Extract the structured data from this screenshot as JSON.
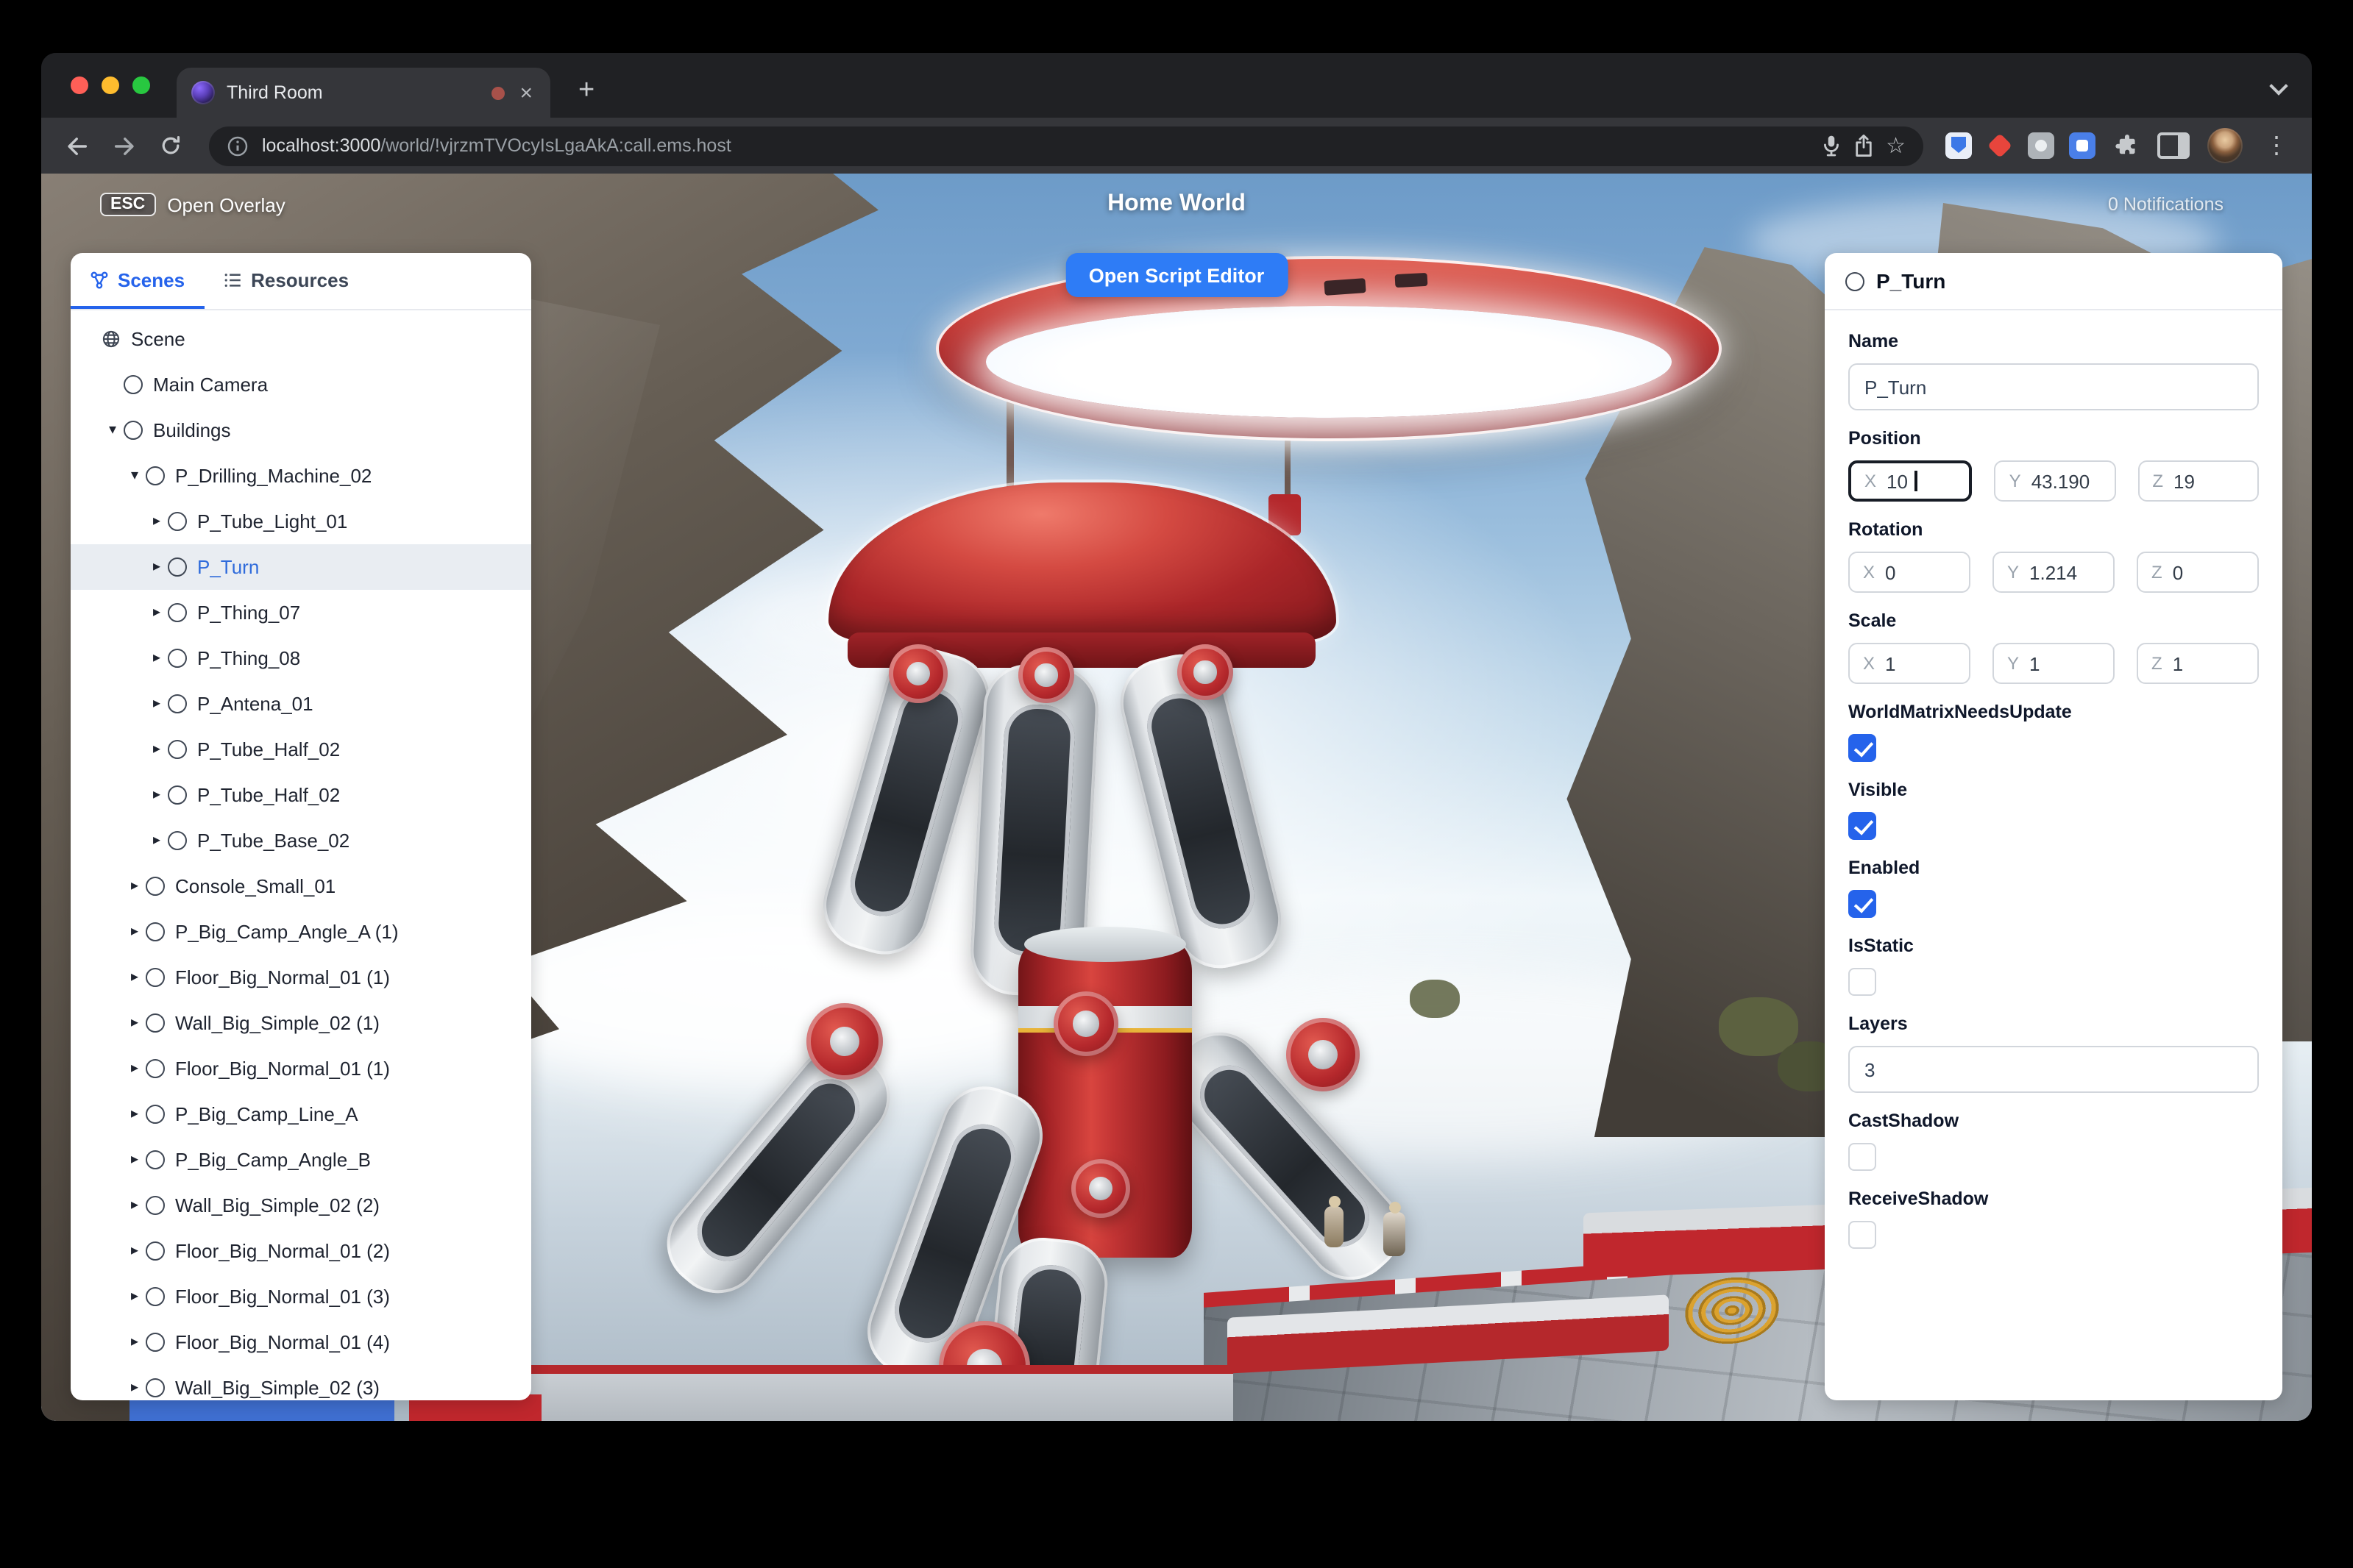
{
  "browser": {
    "tab_title": "Third Room",
    "url_host": "localhost:3000",
    "url_path": "/world/!vjrzmTVOcyIsLgaAkA:call.ems.host"
  },
  "icons": {
    "close": "×",
    "new_tab": "+",
    "star": "☆",
    "kebab": "⋮",
    "expander_open": "▾",
    "expander_closed": "▸"
  },
  "hud": {
    "esc": "ESC",
    "open_overlay": "Open Overlay",
    "title": "Home World",
    "notifications": "0 Notifications",
    "script_button": "Open Script Editor"
  },
  "left_panel": {
    "tabs": [
      {
        "label": "Scenes",
        "active": true
      },
      {
        "label": "Resources",
        "active": false
      }
    ],
    "tree": [
      {
        "label": "Scene",
        "level": 0,
        "icon": "globe",
        "expander": "none"
      },
      {
        "label": "Main Camera",
        "level": 1,
        "icon": "circle",
        "expander": "none"
      },
      {
        "label": "Buildings",
        "level": 1,
        "icon": "circle",
        "expander": "open"
      },
      {
        "label": "P_Drilling_Machine_02",
        "level": 2,
        "icon": "circle",
        "expander": "open"
      },
      {
        "label": "P_Tube_Light_01",
        "level": 3,
        "icon": "circle",
        "expander": "closed"
      },
      {
        "label": "P_Turn",
        "level": 3,
        "icon": "circle",
        "expander": "closed",
        "selected": true
      },
      {
        "label": "P_Thing_07",
        "level": 3,
        "icon": "circle",
        "expander": "closed"
      },
      {
        "label": "P_Thing_08",
        "level": 3,
        "icon": "circle",
        "expander": "closed"
      },
      {
        "label": "P_Antena_01",
        "level": 3,
        "icon": "circle",
        "expander": "closed"
      },
      {
        "label": "P_Tube_Half_02",
        "level": 3,
        "icon": "circle",
        "expander": "closed"
      },
      {
        "label": "P_Tube_Half_02",
        "level": 3,
        "icon": "circle",
        "expander": "closed"
      },
      {
        "label": "P_Tube_Base_02",
        "level": 3,
        "icon": "circle",
        "expander": "closed"
      },
      {
        "label": "Console_Small_01",
        "level": 2,
        "icon": "circle",
        "expander": "closed"
      },
      {
        "label": "P_Big_Camp_Angle_A (1)",
        "level": 2,
        "icon": "circle",
        "expander": "closed"
      },
      {
        "label": "Floor_Big_Normal_01 (1)",
        "level": 2,
        "icon": "circle",
        "expander": "closed"
      },
      {
        "label": "Wall_Big_Simple_02 (1)",
        "level": 2,
        "icon": "circle",
        "expander": "closed"
      },
      {
        "label": "Floor_Big_Normal_01 (1)",
        "level": 2,
        "icon": "circle",
        "expander": "closed"
      },
      {
        "label": "P_Big_Camp_Line_A",
        "level": 2,
        "icon": "circle",
        "expander": "closed"
      },
      {
        "label": "P_Big_Camp_Angle_B",
        "level": 2,
        "icon": "circle",
        "expander": "closed"
      },
      {
        "label": "Wall_Big_Simple_02 (2)",
        "level": 2,
        "icon": "circle",
        "expander": "closed"
      },
      {
        "label": "Floor_Big_Normal_01 (2)",
        "level": 2,
        "icon": "circle",
        "expander": "closed"
      },
      {
        "label": "Floor_Big_Normal_01 (3)",
        "level": 2,
        "icon": "circle",
        "expander": "closed"
      },
      {
        "label": "Floor_Big_Normal_01 (4)",
        "level": 2,
        "icon": "circle",
        "expander": "closed"
      },
      {
        "label": "Wall_Big_Simple_02 (3)",
        "level": 2,
        "icon": "circle",
        "expander": "closed"
      }
    ]
  },
  "inspector": {
    "title": "P_Turn",
    "rows": [
      {
        "type": "text",
        "label": "Name",
        "value": "P_Turn"
      },
      {
        "type": "vector",
        "label": "Position",
        "axes": [
          {
            "axis": "X",
            "value": "10",
            "focused": true
          },
          {
            "axis": "Y",
            "value": "43.190"
          },
          {
            "axis": "Z",
            "value": "19"
          }
        ]
      },
      {
        "type": "vector",
        "label": "Rotation",
        "axes": [
          {
            "axis": "X",
            "value": "0"
          },
          {
            "axis": "Y",
            "value": "1.214"
          },
          {
            "axis": "Z",
            "value": "0"
          }
        ]
      },
      {
        "type": "vector",
        "label": "Scale",
        "axes": [
          {
            "axis": "X",
            "value": "1"
          },
          {
            "axis": "Y",
            "value": "1"
          },
          {
            "axis": "Z",
            "value": "1"
          }
        ]
      },
      {
        "type": "checkbox",
        "label": "WorldMatrixNeedsUpdate",
        "checked": true
      },
      {
        "type": "checkbox",
        "label": "Visible",
        "checked": true
      },
      {
        "type": "checkbox",
        "label": "Enabled",
        "checked": true
      },
      {
        "type": "checkbox",
        "label": "IsStatic",
        "checked": false
      },
      {
        "type": "text",
        "label": "Layers",
        "value": "3"
      },
      {
        "type": "checkbox",
        "label": "CastShadow",
        "checked": false
      },
      {
        "type": "checkbox",
        "label": "ReceiveShadow",
        "checked": false
      }
    ]
  },
  "colors": {
    "accent_blue": "#2563eb",
    "button_blue": "#2e7cf6",
    "machine_red": "#b5282c",
    "chrome_dark": "#202124",
    "chrome_toolbar": "#35363a"
  }
}
